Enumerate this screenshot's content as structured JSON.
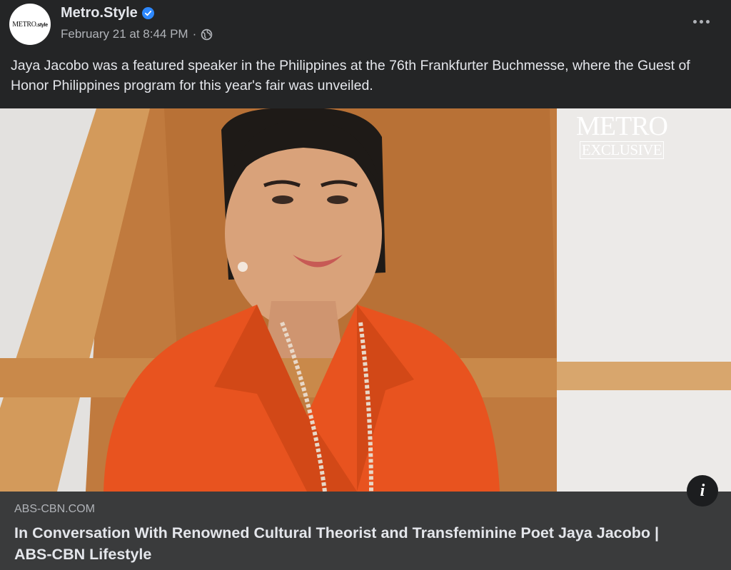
{
  "header": {
    "page_name": "Metro.Style",
    "avatar_logo_main": "METRO",
    "avatar_logo_small": ".style",
    "timestamp": "February 21 at 8:44 PM",
    "separator": "·",
    "privacy_icon": "globe-icon",
    "verified_icon": "verified-badge-icon",
    "more_icon": "more-options-icon"
  },
  "post": {
    "text": "Jaya Jacobo was a featured speaker in the Philippines at the 76th Frankfurter Buchmesse, where the Guest of Honor Philippines program for this year's fair was unveiled."
  },
  "media": {
    "badge_top": "METRO",
    "badge_bottom": "EXCLUSIVE",
    "info_icon": "info-icon",
    "info_glyph": "i"
  },
  "link_preview": {
    "domain": "ABS-CBN.COM",
    "title": "In Conversation With Renowned Cultural Theorist and Transfeminine Poet Jaya Jacobo | ABS-CBN Lifestyle"
  },
  "colors": {
    "background": "#242526",
    "link_box": "#3a3b3c",
    "verified": "#2d88ff",
    "jacket": "#e8531f"
  }
}
